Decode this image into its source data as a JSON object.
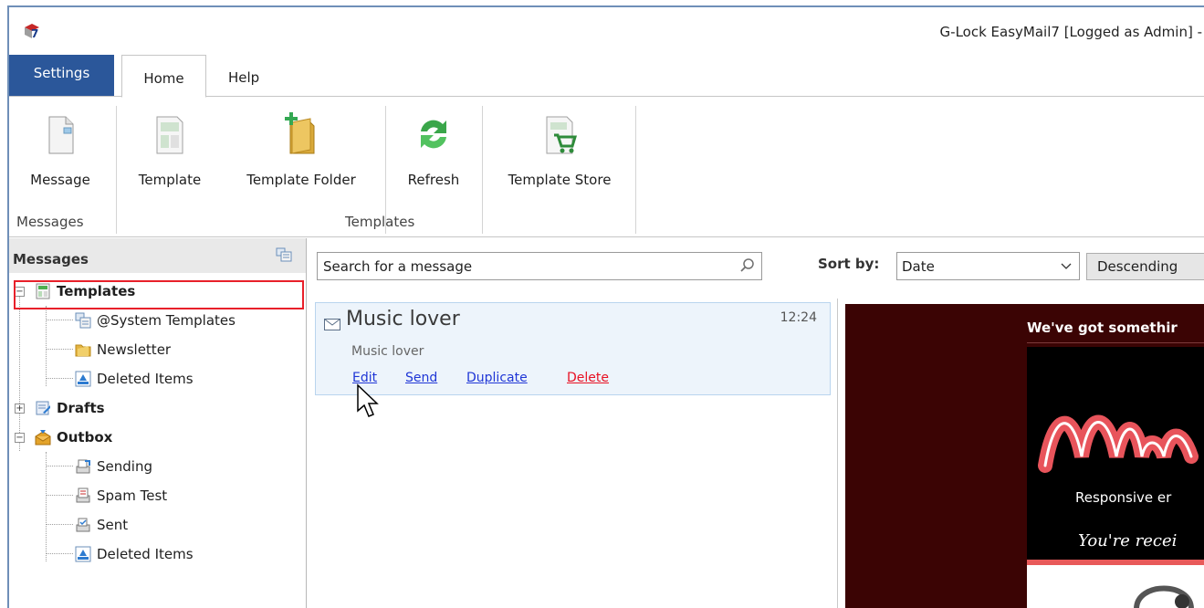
{
  "window": {
    "title": "G-Lock EasyMail7 [Logged as Admin] -"
  },
  "tabs": {
    "settings": "Settings",
    "home": "Home",
    "help": "Help"
  },
  "ribbon": {
    "message": "Message",
    "template": "Template",
    "template_folder": "Template Folder",
    "refresh": "Refresh",
    "template_store": "Template Store",
    "group_messages": "Messages",
    "group_templates": "Templates"
  },
  "left_pane": {
    "title": "Messages",
    "tree": {
      "templates": "Templates",
      "system_templates": "@System Templates",
      "newsletter": "Newsletter",
      "deleted_items_1": "Deleted Items",
      "drafts": "Drafts",
      "outbox": "Outbox",
      "sending": "Sending",
      "spam_test": "Spam Test",
      "sent": "Sent",
      "deleted_items_2": "Deleted Items"
    }
  },
  "search": {
    "placeholder": "Search for a message"
  },
  "sort": {
    "label": "Sort by:",
    "value": "Date",
    "order": "Descending"
  },
  "message_card": {
    "title": "Music lover",
    "time": "12:24",
    "subtitle": "Music lover",
    "actions": {
      "edit": "Edit",
      "send": "Send",
      "duplicate": "Duplicate",
      "delete": "Delete"
    }
  },
  "preview": {
    "header": "We've got somethir",
    "tagline": "Responsive er",
    "receiving": "You're recei"
  },
  "colors": {
    "settings_tab": "#2b579a",
    "link": "#1f36d6",
    "delete_link": "#e81123",
    "selection_outline": "#e8202a",
    "preview_bg": "#3b0404",
    "card_bg": "#edf4fb"
  }
}
